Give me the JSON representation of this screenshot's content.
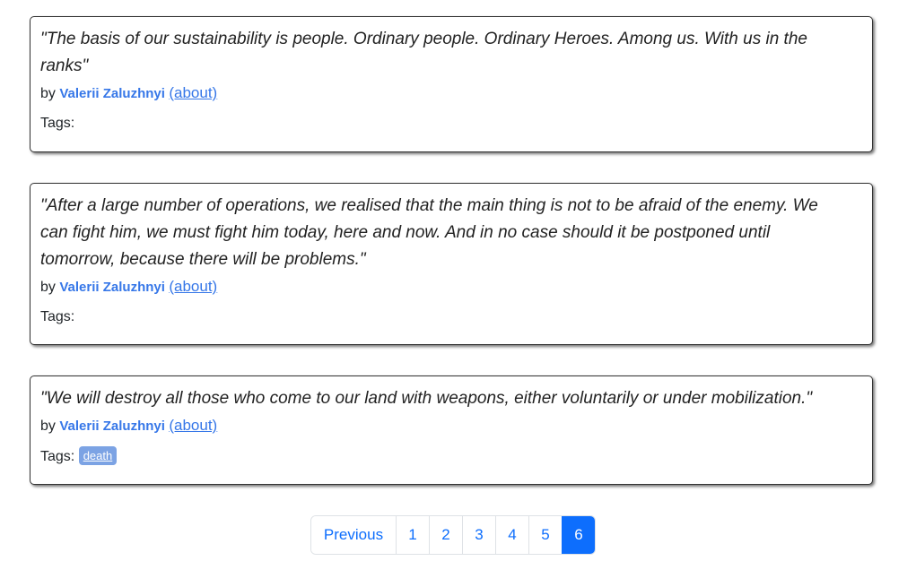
{
  "quotes": [
    {
      "text": "\"The basis of our sustainability is people. Ordinary people. Ordinary Heroes. Among us. With us in the ranks\"",
      "by": "by",
      "author": "Valerii Zaluzhnyi",
      "about": "(about)",
      "tags_label": "Tags:",
      "tags": []
    },
    {
      "text": "\"After a large number of operations, we realised that the main thing is not to be afraid of the enemy. We can fight him, we must fight him today, here and now. And in no case should it be postponed until tomorrow, because there will be problems.\"",
      "by": "by",
      "author": "Valerii Zaluzhnyi",
      "about": "(about)",
      "tags_label": "Tags:",
      "tags": []
    },
    {
      "text": "\"We will destroy all those who come to our land with weapons, either voluntarily or under mobilization.\"",
      "by": "by",
      "author": "Valerii Zaluzhnyi",
      "about": "(about)",
      "tags_label": "Tags:",
      "tags": [
        "death"
      ]
    }
  ],
  "pagination": {
    "previous": "Previous",
    "pages": [
      "1",
      "2",
      "3",
      "4",
      "5",
      "6"
    ],
    "active": "6"
  },
  "colors": {
    "link": "#3677e8",
    "tag_bg": "#7ca3e4",
    "active_page_bg": "#0d6efd"
  }
}
